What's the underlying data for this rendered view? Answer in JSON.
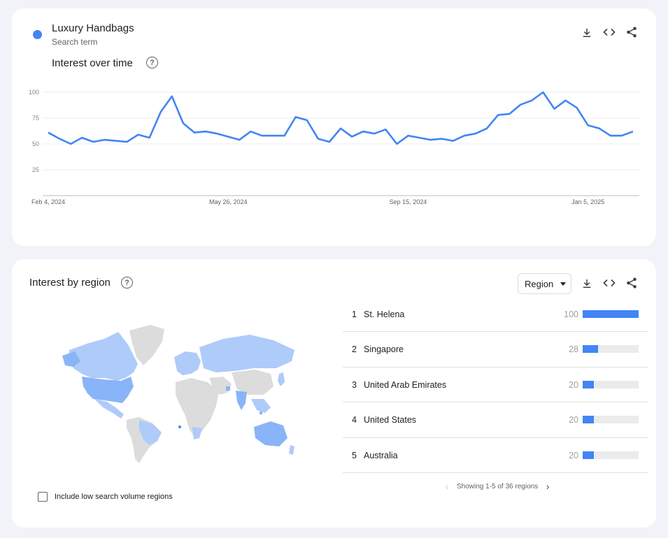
{
  "term": {
    "name": "Luxury Handbags",
    "subtitle": "Search term",
    "color": "#4285f4"
  },
  "time_card": {
    "title": "Interest over time",
    "help_icon": "question-circle-icon",
    "actions": [
      "download-icon",
      "embed-code-icon",
      "share-icon"
    ]
  },
  "chart_data": {
    "type": "line",
    "title": "",
    "xlabel": "",
    "ylabel": "",
    "ylim": [
      0,
      100
    ],
    "yticks": [
      "100",
      "75",
      "50",
      "25"
    ],
    "x_tick_labels": [
      "Feb 4, 2024",
      "May 26, 2024",
      "Sep 15, 2024",
      "Jan 5, 2025"
    ],
    "x": [
      "2024-02-04",
      "2024-02-11",
      "2024-02-18",
      "2024-02-25",
      "2024-03-03",
      "2024-03-10",
      "2024-03-17",
      "2024-03-24",
      "2024-03-31",
      "2024-04-07",
      "2024-04-14",
      "2024-04-21",
      "2024-04-28",
      "2024-05-05",
      "2024-05-12",
      "2024-05-19",
      "2024-05-26",
      "2024-06-02",
      "2024-06-09",
      "2024-06-16",
      "2024-06-23",
      "2024-06-30",
      "2024-07-07",
      "2024-07-14",
      "2024-07-21",
      "2024-07-28",
      "2024-08-04",
      "2024-08-11",
      "2024-08-18",
      "2024-08-25",
      "2024-09-01",
      "2024-09-08",
      "2024-09-15",
      "2024-09-22",
      "2024-09-29",
      "2024-10-06",
      "2024-10-13",
      "2024-10-20",
      "2024-10-27",
      "2024-11-03",
      "2024-11-10",
      "2024-11-17",
      "2024-11-24",
      "2024-12-01",
      "2024-12-08",
      "2024-12-15",
      "2024-12-22",
      "2024-12-29",
      "2025-01-05",
      "2025-01-12",
      "2025-01-19",
      "2025-01-26",
      "2025-02-02"
    ],
    "series": [
      {
        "values": [
          61,
          55,
          50,
          56,
          52,
          54,
          53,
          52,
          59,
          56,
          81,
          96,
          70,
          61,
          62,
          60,
          57,
          54,
          62,
          58,
          58,
          58,
          76,
          73,
          55,
          52,
          65,
          57,
          62,
          60,
          64,
          50,
          58,
          56,
          54,
          55,
          53,
          58,
          60,
          65,
          78,
          79,
          88,
          92,
          100,
          84,
          92,
          85,
          68,
          65,
          58,
          58,
          62
        ]
      }
    ],
    "grid": true,
    "legend": "none"
  },
  "region_card": {
    "title": "Interest by region",
    "help_icon": "question-circle-icon",
    "select_label": "Region",
    "actions": [
      "download-icon",
      "embed-code-icon",
      "share-icon"
    ],
    "rows": [
      {
        "rank": "1",
        "name": "St. Helena",
        "value": "100",
        "fill": 1.0
      },
      {
        "rank": "2",
        "name": "Singapore",
        "value": "28",
        "fill": 0.28
      },
      {
        "rank": "3",
        "name": "United Arab Emirates",
        "value": "20",
        "fill": 0.2
      },
      {
        "rank": "4",
        "name": "United States",
        "value": "20",
        "fill": 0.2
      },
      {
        "rank": "5",
        "name": "Australia",
        "value": "20",
        "fill": 0.2
      }
    ],
    "pager_text": "Showing 1-5 of 36 regions",
    "checkbox_label": "Include low search volume regions",
    "map_colors": {
      "high": "#8ab4f8",
      "mid": "#aecbfa",
      "none": "#dcdcdc"
    }
  }
}
